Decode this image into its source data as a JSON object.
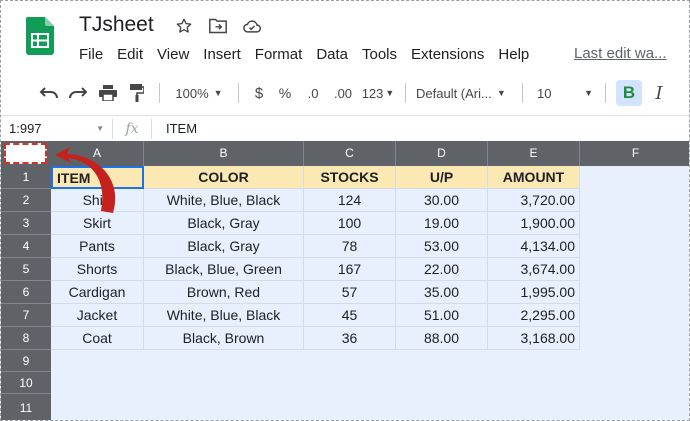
{
  "app": {
    "title": "TJsheet",
    "menu": [
      "File",
      "Edit",
      "View",
      "Insert",
      "Format",
      "Data",
      "Tools",
      "Extensions",
      "Help"
    ],
    "last_edit": "Last edit wa..."
  },
  "toolbar": {
    "zoom": "100%",
    "currency": "$",
    "percent": "%",
    "decrease_decimals": ".0",
    "increase_decimals": ".00",
    "more_formats": "123",
    "font": "Default (Ari...",
    "font_size": "10",
    "bold": "B",
    "italic": "I"
  },
  "formula_bar": {
    "name_box": "1:997",
    "fx": "fx",
    "value": "ITEM"
  },
  "sheet": {
    "columns": [
      "A",
      "B",
      "C",
      "D",
      "E",
      "F"
    ],
    "rows": [
      "1",
      "2",
      "3",
      "4",
      "5",
      "6",
      "7",
      "8",
      "9",
      "10",
      "11"
    ],
    "header": [
      "ITEM",
      "COLOR",
      "STOCKS",
      "U/P",
      "AMOUNT"
    ],
    "data": [
      [
        "Shirt",
        "White, Blue, Black",
        "124",
        "30.00",
        "3,720.00"
      ],
      [
        "Skirt",
        "Black, Gray",
        "100",
        "19.00",
        "1,900.00"
      ],
      [
        "Pants",
        "Black, Gray",
        "78",
        "53.00",
        "4,134.00"
      ],
      [
        "Shorts",
        "Black, Blue, Green",
        "167",
        "22.00",
        "3,674.00"
      ],
      [
        "Cardigan",
        "Brown, Red",
        "57",
        "35.00",
        "1,995.00"
      ],
      [
        "Jacket",
        "White, Blue, Black",
        "45",
        "51.00",
        "2,295.00"
      ],
      [
        "Coat",
        "Black, Brown",
        "36",
        "88.00",
        "3,168.00"
      ]
    ]
  },
  "colors": {
    "header_fill": "#fce8b2",
    "selection_fill": "#e8f0fe",
    "grid_header": "#5f6368",
    "annotation": "#d93025"
  }
}
